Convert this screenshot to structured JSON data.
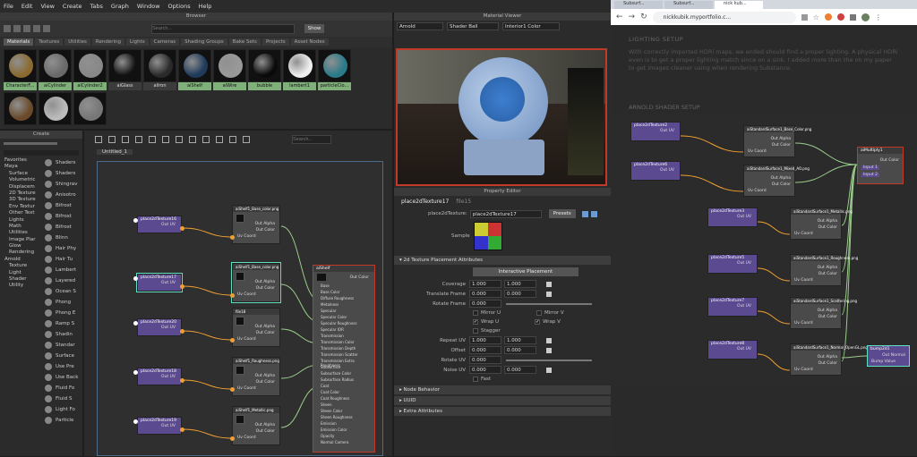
{
  "maya": {
    "menu": [
      "File",
      "Edit",
      "View",
      "Create",
      "Tabs",
      "Graph",
      "Window",
      "Options",
      "Help"
    ],
    "browser": {
      "title": "Browser",
      "search_placeholder": "Search...",
      "show_label": "Show",
      "tabs": [
        "Materials",
        "Textures",
        "Utilities",
        "Rendering",
        "Lights",
        "Cameras",
        "Shading Groups",
        "Bake Sets",
        "Projects",
        "Asset Nodes"
      ],
      "materials": [
        "CharacterF...",
        "aiCylinder",
        "aiCylinder2",
        "aiGlass",
        "aiIron",
        "aiShelf",
        "aiWire",
        "bubble",
        "lambert1",
        "particleClo..."
      ]
    },
    "material_viewer": {
      "title": "Material Viewer",
      "renderer": "Arnold",
      "shape": "Shader Ball",
      "env": "Interior1 Color"
    },
    "create_panel": {
      "title": "Create",
      "tree": [
        "Favorites",
        "Maya",
        "Surface",
        "Volumetric",
        "Displacem",
        "2D Texture",
        "3D Texture",
        "Env Textur",
        "Other Text",
        "Lights",
        "Math",
        "Utilities",
        "Image Plar",
        "Glow",
        "Rendering",
        "Arnold",
        "Texture",
        "Light",
        "Shader",
        "Utility"
      ],
      "list": [
        "Shaders",
        "Shaders",
        "Shingrav",
        "Anisotro",
        "Bifrost",
        "Bifrost",
        "Bifrost",
        "Blinn",
        "Hair Phy",
        "Hair Tu",
        "Lambert",
        "Layered",
        "Ocean S",
        "Phong",
        "Phong E",
        "Ramp S",
        "Shadin",
        "Standar",
        "Surface",
        "Use Pre",
        "Use Back",
        "Fluid Fo",
        "Fluid S",
        "Light Fo",
        "Particle"
      ]
    },
    "graph": {
      "tab": "Untitled_1",
      "search_placeholder": "Search...",
      "place_nodes": [
        "place2dTexture16",
        "place2dTexture17",
        "place2dTexture20",
        "place2dTexture18",
        "place2dTexture19"
      ],
      "file_nodes": [
        "aiShelf1_Base_color.png",
        "aiShelf1_Base_color.png",
        "file18",
        "aiShelf1_Roughness.png",
        "aiShelf1_Metallic.png"
      ],
      "out_uv": "Out UV",
      "file_ports": [
        "Out Alpha",
        "Out Color",
        "Uv Coord"
      ],
      "shader": {
        "title": "aiShelf",
        "out": "Out Color",
        "ports": [
          "Base",
          "Base Color",
          "Diffuse Roughness",
          "Metalness",
          "Specular",
          "Specular Color",
          "Specular Roughness",
          "Specular IOR",
          "Transmission",
          "Transmission Color",
          "Transmission Depth",
          "Transmission Scatter",
          "Transmission Extra Roughness",
          "Subsurface",
          "Subsurface Color",
          "Subsurface Radius",
          "Coat",
          "Coat Color",
          "Coat Roughness",
          "Sheen",
          "Sheen Color",
          "Sheen Roughness",
          "Emission",
          "Emission Color",
          "Opacity",
          "Normal Camera"
        ]
      }
    },
    "property_editor": {
      "title": "Property Editor",
      "tabs": [
        "place2dTexture17",
        "file15"
      ],
      "type_label": "place2dTexture:",
      "name": "place2dTexture17",
      "presets": "Presets",
      "sample": "Sample",
      "section": "2d Texture Placement Attributes",
      "interactive": "Interactive Placement",
      "coverage": {
        "label": "Coverage",
        "u": "1.000",
        "v": "1.000"
      },
      "translate": {
        "label": "Translate Frame",
        "u": "0.000",
        "v": "0.000"
      },
      "rotate_frame": {
        "label": "Rotate Frame",
        "v": "0.000"
      },
      "mirror_u": "Mirror U",
      "mirror_v": "Mirror V",
      "wrap_u": "Wrap U",
      "wrap_v": "Wrap V",
      "stagger": "Stagger",
      "repeat": {
        "label": "Repeat UV",
        "u": "1.000",
        "v": "1.000"
      },
      "offset": {
        "label": "Offset",
        "u": "0.000",
        "v": "0.000"
      },
      "rotate_uv": {
        "label": "Rotate UV",
        "v": "0.000"
      },
      "noise": {
        "label": "Noise UV",
        "u": "0.000",
        "v": "0.000"
      },
      "fast": "Fast",
      "collapsed": [
        "Node Behavior",
        "UUID",
        "Extra Attributes"
      ]
    }
  },
  "chrome": {
    "tab1": "Subsurf...",
    "tab2": "Subsurf...",
    "tab3": "nick kub...",
    "url": "nickkubik.myportfolio.c...",
    "heading": "LIGHTING SETUP",
    "paragraph": "With correctly imported HDRi maps, we ended should find a proper lighting. A physical HDRi even is to get a proper lighting match since on a sink. I added more than the on my paper to get images cleaner using when rendering Substance.",
    "subheading": "ARNOLD SHADER SETUP",
    "place_nodes": [
      "place2dTexture2",
      "place2dTexture6",
      "place2dTexture3",
      "place2dTexture5",
      "place2dTexture7",
      "place2dTexture8"
    ],
    "std_nodes": [
      "aiStandardSurface1_Base_Color.png",
      "aiStandardSurface1_Mixed_AO.png",
      "aiStandardSurface1_Metallic.png",
      "aiStandardSurface1_Roughness.png",
      "aiStandardSurface1_Scattering.png",
      "aiStandardSurface1_Normal_OpenGL.png"
    ],
    "multiply": "aiMultiply1",
    "bump": "bump2d1",
    "multiply_ports": [
      "Out Color",
      "Input 1",
      "Input 2"
    ],
    "bump_ports": [
      "Out Normal",
      "Bump Value"
    ],
    "out_uv": "Out UV",
    "file_ports": [
      "Out Alpha",
      "Out Color",
      "Uv Coord"
    ]
  },
  "colors": {
    "accent_orange": "#f0a030",
    "node_purple": "#5b4a8f",
    "selected_green": "#7fb07a",
    "red_border": "#c0392b"
  }
}
